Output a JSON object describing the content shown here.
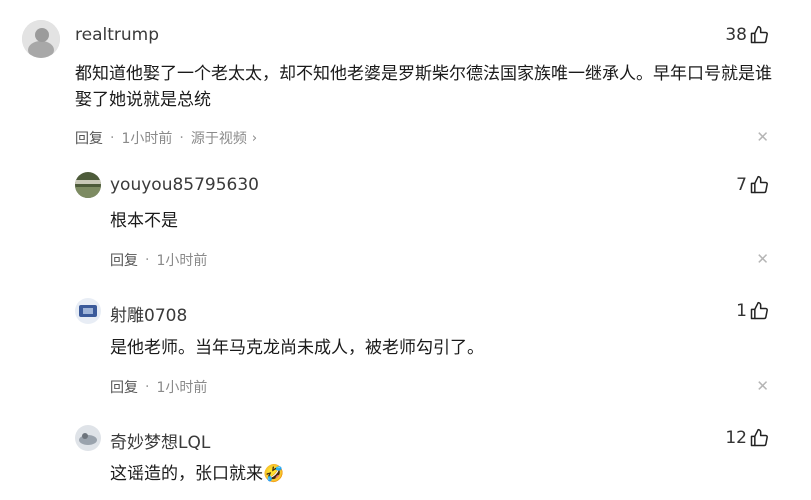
{
  "comments": [
    {
      "user": "realtrump",
      "text": "都知道他娶了一个老太太，却不知他老婆是罗斯柴尔德法国家族唯一继承人。早年口号就是谁娶了她说就是总统",
      "reply_label": "回复",
      "time": "1小时前",
      "source": "源于视频",
      "likes": "38",
      "avatar_color": "#cfcfcf"
    },
    {
      "user": "youyou85795630",
      "text": "根本不是",
      "reply_label": "回复",
      "time": "1小时前",
      "likes": "7",
      "avatar_color": "#5b6a45"
    },
    {
      "user": "射雕0708",
      "text": "是他老师。当年马克龙尚未成人，被老师勾引了。",
      "reply_label": "回复",
      "time": "1小时前",
      "likes": "1",
      "avatar_color": "#3b5a9a"
    },
    {
      "user": "奇妙梦想LQL",
      "text": "这谣造的，张口就来🤣",
      "likes": "12",
      "avatar_color": "#9aa3ad"
    }
  ],
  "icons": {
    "like": "thumbs-up-icon",
    "close": "close-icon",
    "chevron": "chevron-right-icon"
  }
}
